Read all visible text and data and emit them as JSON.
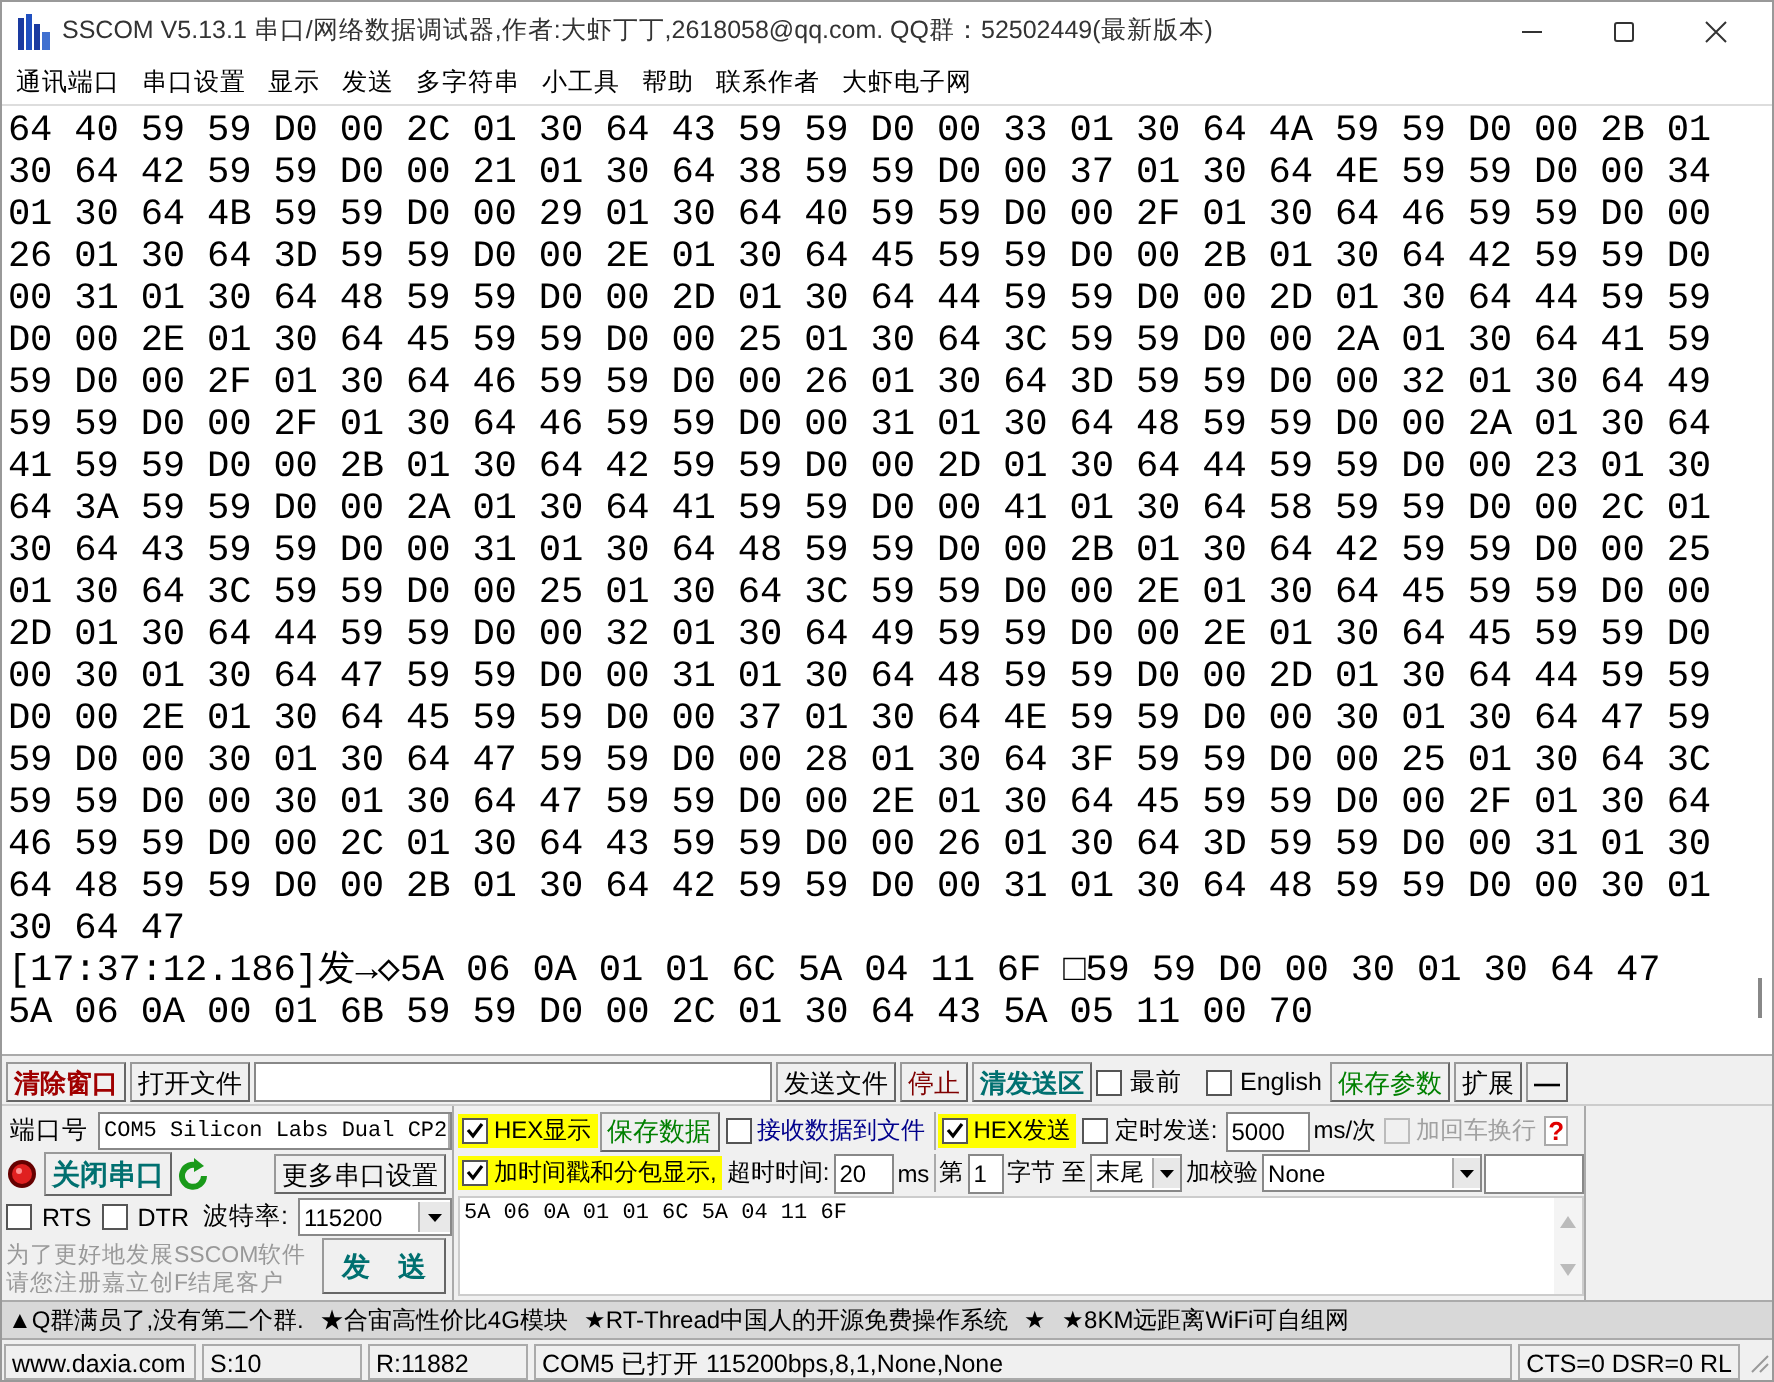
{
  "window": {
    "title": "SSCOM V5.13.1 串口/网络数据调试器,作者:大虾丁丁,2618058@qq.com. QQ群：52502449(最新版本)"
  },
  "menu": [
    "通讯端口",
    "串口设置",
    "显示",
    "发送",
    "多字符串",
    "小工具",
    "帮助",
    "联系作者",
    "大虾电子网"
  ],
  "receive_log": {
    "lines": [
      "64 40 59 59 D0 00 2C 01 30 64 43 59 59 D0 00 33 01 30 64 4A 59 59 D0 00 2B 01",
      "30 64 42 59 59 D0 00 21 01 30 64 38 59 59 D0 00 37 01 30 64 4E 59 59 D0 00 34",
      "01 30 64 4B 59 59 D0 00 29 01 30 64 40 59 59 D0 00 2F 01 30 64 46 59 59 D0 00",
      "26 01 30 64 3D 59 59 D0 00 2E 01 30 64 45 59 59 D0 00 2B 01 30 64 42 59 59 D0",
      "00 31 01 30 64 48 59 59 D0 00 2D 01 30 64 44 59 59 D0 00 2D 01 30 64 44 59 59",
      "D0 00 2E 01 30 64 45 59 59 D0 00 25 01 30 64 3C 59 59 D0 00 2A 01 30 64 41 59",
      "59 D0 00 2F 01 30 64 46 59 59 D0 00 26 01 30 64 3D 59 59 D0 00 32 01 30 64 49",
      "59 59 D0 00 2F 01 30 64 46 59 59 D0 00 31 01 30 64 48 59 59 D0 00 2A 01 30 64",
      "41 59 59 D0 00 2B 01 30 64 42 59 59 D0 00 2D 01 30 64 44 59 59 D0 00 23 01 30",
      "64 3A 59 59 D0 00 2A 01 30 64 41 59 59 D0 00 41 01 30 64 58 59 59 D0 00 2C 01",
      "30 64 43 59 59 D0 00 31 01 30 64 48 59 59 D0 00 2B 01 30 64 42 59 59 D0 00 25",
      "01 30 64 3C 59 59 D0 00 25 01 30 64 3C 59 59 D0 00 2E 01 30 64 45 59 59 D0 00",
      "2D 01 30 64 44 59 59 D0 00 32 01 30 64 49 59 59 D0 00 2E 01 30 64 45 59 59 D0",
      "00 30 01 30 64 47 59 59 D0 00 31 01 30 64 48 59 59 D0 00 2D 01 30 64 44 59 59",
      "D0 00 2E 01 30 64 45 59 59 D0 00 37 01 30 64 4E 59 59 D0 00 30 01 30 64 47 59",
      "59 D0 00 30 01 30 64 47 59 59 D0 00 28 01 30 64 3F 59 59 D0 00 25 01 30 64 3C",
      "59 59 D0 00 30 01 30 64 47 59 59 D0 00 2E 01 30 64 45 59 59 D0 00 2F 01 30 64",
      "46 59 59 D0 00 2C 01 30 64 43 59 59 D0 00 26 01 30 64 3D 59 59 D0 00 31 01 30",
      "64 48 59 59 D0 00 2B 01 30 64 42 59 59 D0 00 31 01 30 64 48 59 59 D0 00 30 01",
      "30 64 47",
      "[17:37:12.186]发→◇5A 06 0A 01 01 6C 5A 04 11 6F □59 59 D0 00 30 01 30 64 47",
      "5A 06 0A 00 01 6B 59 59 D0 00 2C 01 30 64 43 5A 05 11 00 70"
    ]
  },
  "toolbar": {
    "clear_button": "清除窗口",
    "open_file_button": "打开文件",
    "send_file_button": "发送文件",
    "stop_button": "停止",
    "clear_send_button": "清发送区",
    "topmost": {
      "label": "最前",
      "checked": false
    },
    "english": {
      "label": "English",
      "checked": false
    },
    "save_params_button": "保存参数",
    "expand_button": "扩展",
    "collapse_button": "—"
  },
  "port": {
    "label": "端口号",
    "value": "COM5 Silicon Labs Dual CP2",
    "close_button": "关闭串口",
    "more_settings_button": "更多串口设置",
    "rts": {
      "label": "RTS",
      "checked": false
    },
    "dtr": {
      "label": "DTR",
      "checked": false
    },
    "baud_label": "波特率:",
    "baud_value": "115200",
    "note": [
      "为了更好地发展SSCOM软件",
      "请您注册嘉立创F结尾客户"
    ],
    "send_button": "发　送"
  },
  "options": {
    "hex_display": {
      "label": "HEX显示",
      "checked": true
    },
    "save_data_button": "保存数据",
    "receive_to_file": {
      "label": "接收数据到文件",
      "checked": false
    },
    "hex_send": {
      "label": "HEX发送",
      "checked": true
    },
    "timed_send": {
      "label": "定时发送:",
      "checked": false
    },
    "interval": "5000",
    "interval_unit": "ms/次",
    "add_crlf": {
      "label": "加回车换行",
      "checked": false,
      "disabled": true
    },
    "help_mark": "?",
    "timestamp": {
      "label": "加时间戳和分包显示,",
      "checked": true
    },
    "timeout_label": "超时时间:",
    "timeout": "20",
    "timeout_unit": "ms",
    "byte_prefix": "第",
    "byte_from": "1",
    "byte_label": "字节 至",
    "byte_to": "末尾",
    "checksum_label": "加校验",
    "checksum": "None"
  },
  "send_text": "5A 06 0A 01 01 6C 5A 04 11 6F",
  "marquee": [
    "▲Q群满员了,没有第二个群.",
    "★合宙高性价比4G模块",
    "★RT-Thread中国人的开源免费操作系统",
    "★",
    "★8KM远距离WiFi可自组网"
  ],
  "status_bar": {
    "website": "www.daxia.com",
    "sent": "S:10",
    "received": "R:11882",
    "port_state": "COM5 已打开  115200bps,8,1,None,None",
    "lines": "CTS=0 DSR=0 RL"
  }
}
